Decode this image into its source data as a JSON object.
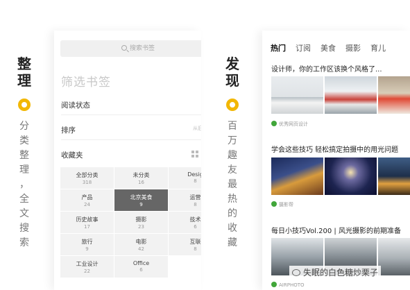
{
  "left_caption": {
    "title": [
      "整",
      "理"
    ],
    "subtitle": [
      "分",
      "类",
      "整",
      "理",
      "，",
      "全",
      "文",
      "搜",
      "索"
    ]
  },
  "right_caption": {
    "title": [
      "发",
      "现"
    ],
    "subtitle": [
      "百",
      "万",
      "趣",
      "友",
      "最",
      "热",
      "的",
      "收",
      "藏"
    ]
  },
  "bookmarks": {
    "search_placeholder": "搜索书签",
    "filter_title": "筛选书签",
    "read_status_label": "阅读状态",
    "sort_label": "排序",
    "sort_value": "从旧",
    "folders_label": "收藏夹",
    "folders": [
      {
        "name": "全部分类",
        "count": "318"
      },
      {
        "name": "未分类",
        "count": "16"
      },
      {
        "name": "Desig",
        "count": "8"
      },
      {
        "name": "产品",
        "count": "24"
      },
      {
        "name": "北京美食",
        "count": "9",
        "selected": true
      },
      {
        "name": "运营",
        "count": "8"
      },
      {
        "name": "历史故事",
        "count": "17"
      },
      {
        "name": "摄影",
        "count": "23"
      },
      {
        "name": "技术",
        "count": "6"
      },
      {
        "name": "旅行",
        "count": "9"
      },
      {
        "name": "电影",
        "count": "42"
      },
      {
        "name": "互联",
        "count": "8"
      },
      {
        "name": "工业设计",
        "count": "22"
      },
      {
        "name": "Office",
        "count": "6"
      }
    ]
  },
  "discover": {
    "tabs": [
      "热门",
      "订阅",
      "美食",
      "摄影",
      "育儿"
    ],
    "active_tab": 0,
    "articles": [
      {
        "title": "设计师，你的工作区该换个风格了...",
        "source": "优秀网页设计"
      },
      {
        "title": "学会这些技巧 轻松搞定拍摄中的用光问题",
        "source": "摄影帮"
      },
      {
        "title": "每日小技巧Vol.200 | 风光摄影的前期准备",
        "source": "AIRPHOTO"
      }
    ]
  },
  "watermark": "失眠的白色糖炒栗子",
  "colors": {
    "accent": "#f2b705",
    "selected_tile": "#666666",
    "wechat_green": "#41a63a"
  }
}
